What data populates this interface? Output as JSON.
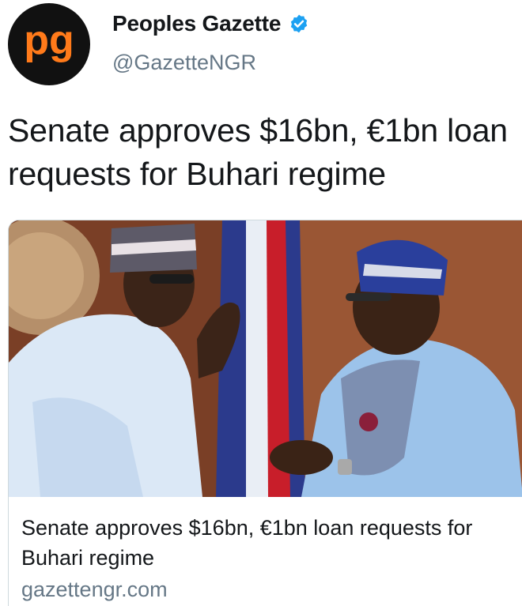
{
  "account": {
    "display_name": "Peoples Gazette",
    "handle": "@GazetteNGR",
    "avatar_text": "pg",
    "verified_icon": "verified-badge-icon",
    "brand_color": "#ff7a1a",
    "verified_color": "#1da1f2"
  },
  "tweet": {
    "text": "Senate approves $16bn, €1bn loan requests for Buhari regime"
  },
  "link_card": {
    "title": "Senate approves $16bn, €1bn loan requests for Buhari regime",
    "domain": "gazettengr.com",
    "image_alt": "photo-of-two-men-in-traditional-attire"
  }
}
